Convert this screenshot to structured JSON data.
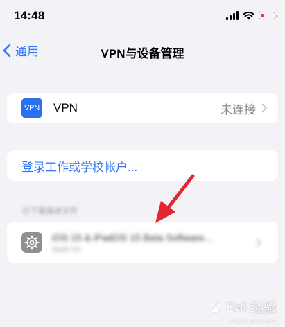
{
  "status_bar": {
    "time": "14:48"
  },
  "nav": {
    "back_label": "通用",
    "title": "VPN与设备管理"
  },
  "vpn": {
    "badge": "VPN",
    "label": "VPN",
    "status": "未连接"
  },
  "signin": {
    "label": "登录工作或学校帐户..."
  },
  "profiles": {
    "header": "已下载描述文件",
    "item": {
      "name": "iOS 15 & iPadOS 15 Beta Software...",
      "subtitle": "Apple Inc."
    }
  },
  "watermark": {
    "text": "Bai 经验",
    "url": "jingyan.baidu.com"
  },
  "colors": {
    "accent": "#3478f6",
    "vpn_badge": "#2c6ff0",
    "arrow": "#e3262f",
    "battery_low": "#e53935"
  }
}
